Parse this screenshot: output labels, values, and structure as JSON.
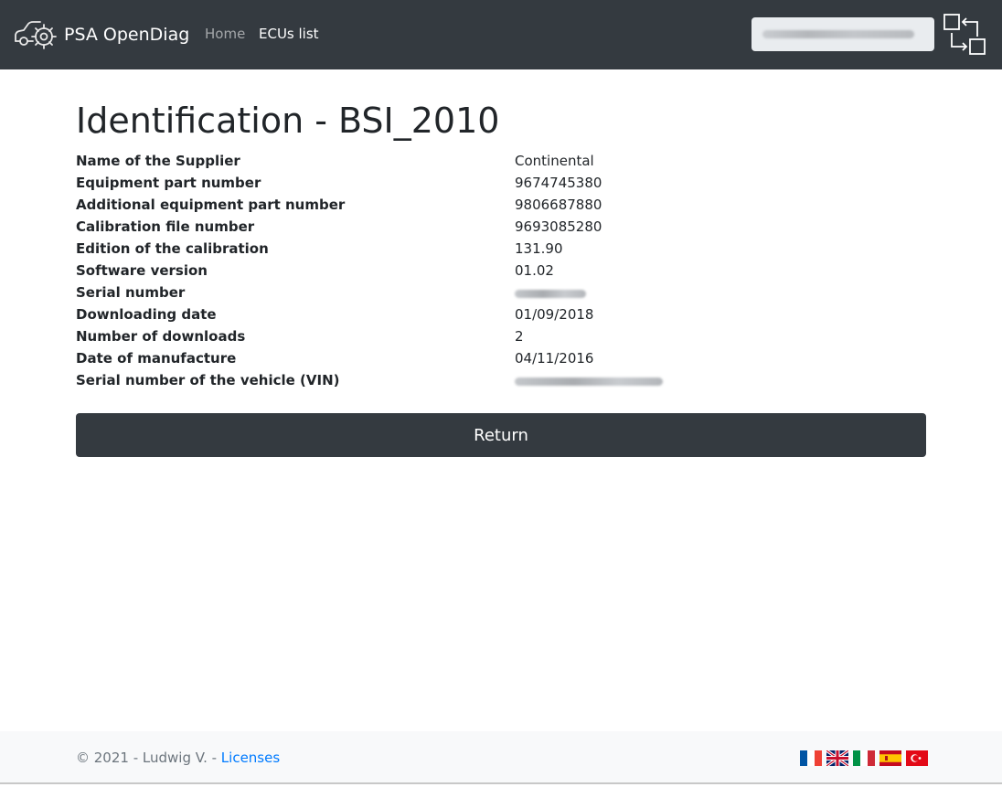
{
  "app": {
    "brand": "PSA OpenDiag",
    "nav": {
      "home": "Home",
      "ecus": "ECUs list"
    },
    "vin_field": {
      "value_redacted": true
    }
  },
  "main": {
    "title": "Identification - BSI_2010",
    "rows": [
      {
        "label": "Name of the Supplier",
        "value": "Continental"
      },
      {
        "label": "Equipment part number",
        "value": "9674745380"
      },
      {
        "label": "Additional equipment part number",
        "value": "9806687880"
      },
      {
        "label": "Calibration file number",
        "value": "9693085280"
      },
      {
        "label": "Edition of the calibration",
        "value": "131.90"
      },
      {
        "label": "Software version",
        "value": "01.02"
      },
      {
        "label": "Serial number",
        "redacted": true
      },
      {
        "label": "Downloading date",
        "value": "01/09/2018"
      },
      {
        "label": "Number of downloads",
        "value": "2"
      },
      {
        "label": "Date of manufacture",
        "value": "04/11/2016"
      },
      {
        "label": "Serial number of the vehicle (VIN)",
        "redacted": true
      }
    ],
    "return_button": "Return"
  },
  "footer": {
    "copyright": "© 2021 - Ludwig V. - ",
    "licenses_link": "Licenses",
    "flags": [
      "flag-france",
      "flag-uk",
      "flag-italy",
      "flag-spain",
      "flag-turkey"
    ]
  },
  "colors": {
    "navbar_bg": "#343a40",
    "button_bg": "#343a40",
    "link": "#007bff",
    "footer_bg": "#f8f9fa"
  }
}
